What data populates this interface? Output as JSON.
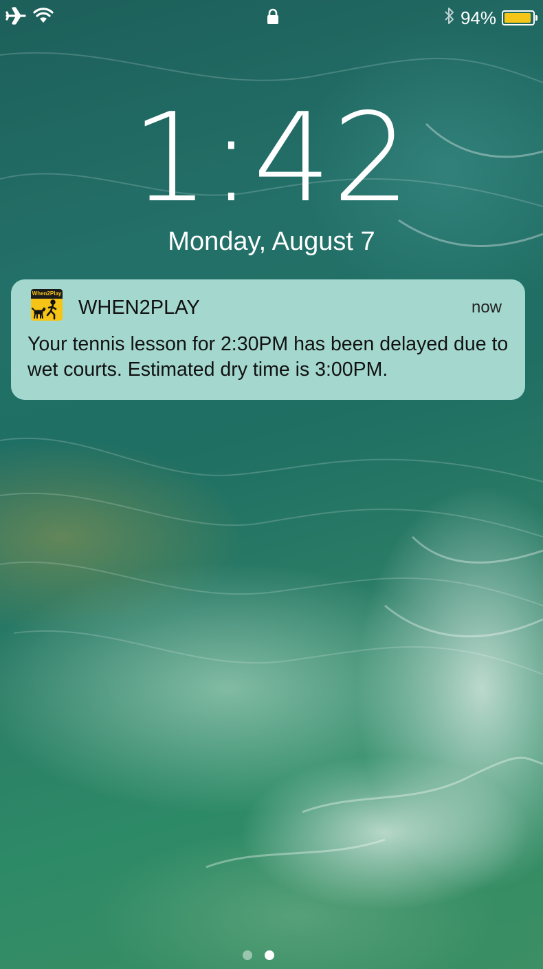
{
  "status_bar": {
    "left_icons": [
      "airplane-icon",
      "wifi-icon"
    ],
    "center_icon": "lock-icon",
    "right_icons": [
      "bluetooth-icon",
      "battery-icon"
    ],
    "battery_percent": "94%",
    "battery_level": 0.94,
    "battery_color": "#f5c518"
  },
  "lock_screen": {
    "time": "1:42",
    "date": "Monday, August 7"
  },
  "notification": {
    "app_icon_text": "When2Play",
    "app_name": "WHEN2PLAY",
    "time": "now",
    "message": "Your tennis lesson for 2:30PM has been delayed due to wet courts. Estimated dry time is 3:00PM.",
    "background_color": "#a4d8cf",
    "app_icon_color": "#f6c416"
  },
  "page_indicator": {
    "pages": 2,
    "current": 2
  }
}
